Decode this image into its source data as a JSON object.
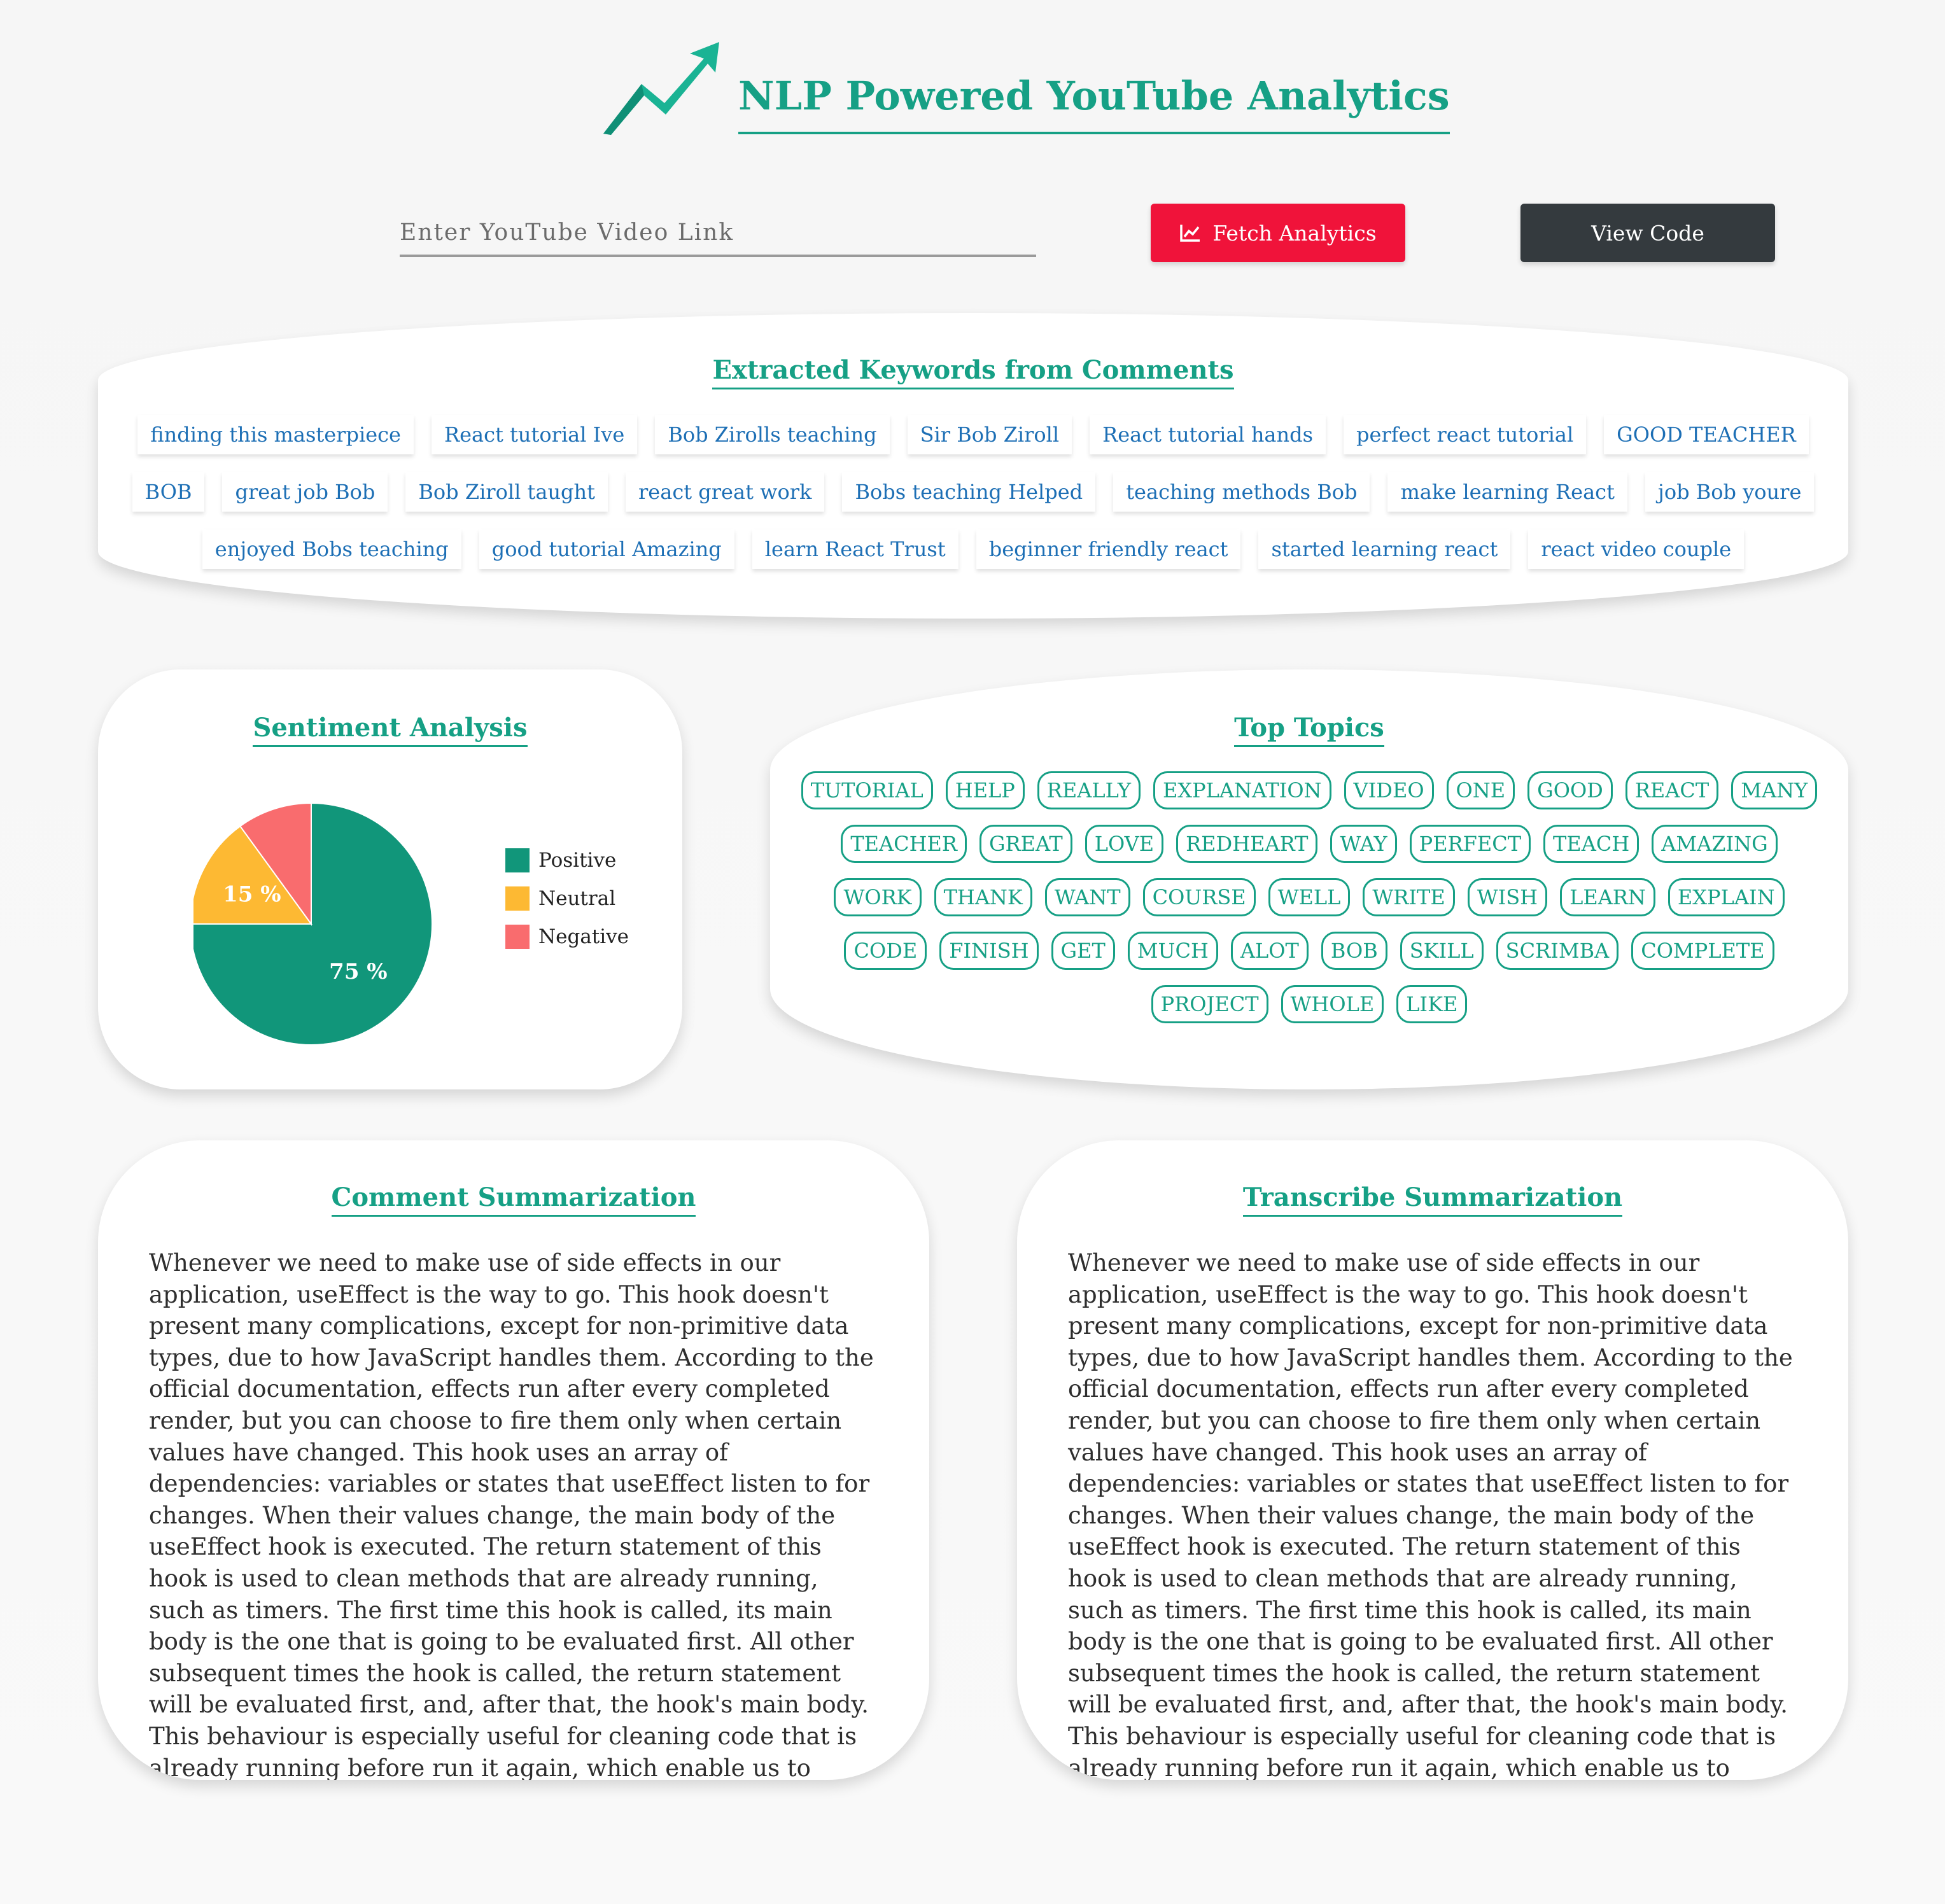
{
  "header": {
    "title": "NLP Powered YouTube Analytics",
    "logo_icon": "trending-up-arrow-icon"
  },
  "input": {
    "placeholder": "Enter YouTube Video Link",
    "value": ""
  },
  "buttons": {
    "fetch_label": "Fetch Analytics",
    "fetch_icon": "line-chart-icon",
    "code_label": "View Code"
  },
  "keywords": {
    "title": "Extracted Keywords from Comments",
    "rows": [
      [
        "finding this masterpiece",
        "React tutorial Ive",
        "Bob Zirolls teaching",
        "Sir Bob Ziroll",
        "React tutorial hands",
        "perfect react tutorial",
        "GOOD TEACHER"
      ],
      [
        "BOB",
        "great job Bob",
        "Bob Ziroll taught",
        "react great work",
        "Bobs teaching Helped",
        "teaching methods Bob",
        "make learning React",
        "job Bob youre"
      ],
      [
        "enjoyed Bobs teaching",
        "good tutorial Amazing",
        "learn React Trust",
        "beginner friendly react",
        "started learning react",
        "react video couple"
      ]
    ]
  },
  "sentiment": {
    "title": "Sentiment Analysis",
    "legend": [
      "Positive",
      "Neutral",
      "Negative"
    ]
  },
  "chart_data": {
    "type": "pie",
    "categories": [
      "Positive",
      "Neutral",
      "Negative"
    ],
    "values": [
      75,
      15,
      10
    ],
    "labels": [
      "75 %",
      "15 %",
      ""
    ],
    "colors": [
      "#11967a",
      "#fdb933",
      "#f96c6e"
    ],
    "legend_position": "right"
  },
  "topics": {
    "title": "Top Topics",
    "rows": [
      [
        "TUTORIAL",
        "HELP",
        "REALLY",
        "EXPLANATION",
        "VIDEO",
        "ONE",
        "GOOD",
        "REACT",
        "MANY"
      ],
      [
        "TEACHER",
        "GREAT",
        "LOVE",
        "REDHEART",
        "WAY",
        "PERFECT",
        "TEACH",
        "AMAZING"
      ],
      [
        "WORK",
        "THANK",
        "WANT",
        "COURSE",
        "WELL",
        "WRITE",
        "WISH",
        "LEARN",
        "EXPLAIN"
      ],
      [
        "CODE",
        "FINISH",
        "GET",
        "MUCH",
        "ALOT",
        "BOB",
        "SKILL",
        "SCRIMBA",
        "COMPLETE"
      ],
      [
        "PROJECT",
        "WHOLE",
        "LIKE"
      ]
    ]
  },
  "comment_summary": {
    "title": "Comment Summarization",
    "text": "Whenever we need to make use of side effects in our application, useEffect is the way to go. This hook doesn't present many complications, except for non-primitive data types, due to how JavaScript handles them. According to the official documentation, effects run after every completed render, but you can choose to fire them only when certain values have changed. This hook uses an array of dependencies: variables or states that useEffect listen to for changes. When their values change, the main body of the useEffect hook is executed. The return statement of this hook is used to clean methods that are already running, such as timers. The first time this hook is called, its main body is the one that is going to be evaluated first. All other subsequent times the hook is called, the return statement will be evaluated first, and, after that, the hook's main body. This behaviour is especially useful for cleaning code that is already running before run it again, which enable us to prevent memory leaks. There is an interesting behaviour with this hook when we"
  },
  "transcribe_summary": {
    "title": "Transcribe Summarization",
    "text": "Whenever we need to make use of side effects in our application, useEffect is the way to go. This hook doesn't present many complications, except for non-primitive data types, due to how JavaScript handles them. According to the official documentation, effects run after every completed render, but you can choose to fire them only when certain values have changed. This hook uses an array of dependencies: variables or states that useEffect listen to for changes. When their values change, the main body of the useEffect hook is executed. The return statement of this hook is used to clean methods that are already running, such as timers. The first time this hook is called, its main body is the one that is going to be evaluated first. All other subsequent times the hook is called, the return statement will be evaluated first, and, after that, the hook's main body. This behaviour is especially useful for cleaning code that is already running before run it again, which enable us to prevent memory leaks. There is an interesting behaviour with this hook when we"
  }
}
